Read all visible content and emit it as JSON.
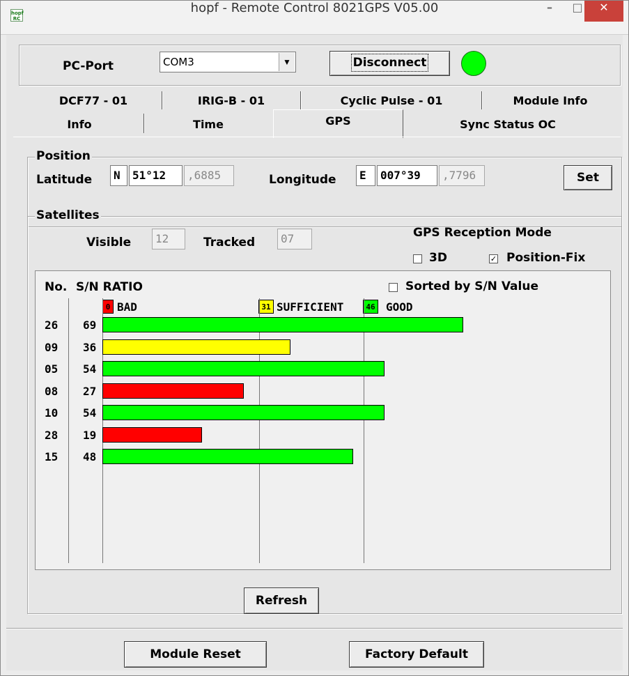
{
  "window": {
    "title": "hopf - Remote Control  8021GPS V05.00",
    "app_icon_text": "hopf RC",
    "minimize_symbol": "–",
    "maximize_symbol": "□",
    "close_symbol": "✕"
  },
  "connection": {
    "port_label": "PC-Port",
    "port_value": "COM3",
    "dropdown_arrow": "▼",
    "disconnect_label": "Disconnect",
    "status_color": "#00ff00"
  },
  "tabs": {
    "row1": [
      "DCF77 - 01",
      "IRIG-B - 01",
      "Cyclic Pulse - 01",
      "Module Info"
    ],
    "row2": [
      "Info",
      "Time",
      "GPS",
      "Sync Status OC"
    ],
    "active": "GPS"
  },
  "position": {
    "group_label": "Position",
    "latitude_label": "Latitude",
    "lat_hemisphere": "N",
    "lat_degrees": "51°12",
    "lat_minutes": ",6885",
    "longitude_label": "Longitude",
    "lon_hemisphere": "E",
    "lon_degrees": "007°39",
    "lon_minutes": ",7796",
    "set_label": "Set"
  },
  "satellites": {
    "group_label": "Satellites",
    "visible_label": "Visible",
    "visible_value": "12",
    "tracked_label": "Tracked",
    "tracked_value": "07",
    "reception_mode_label": "GPS Reception Mode",
    "mode_3d_label": "3D",
    "mode_3d_checked": false,
    "mode_posfix_label": "Position-Fix",
    "mode_posfix_checked": true
  },
  "sn_list": {
    "header_no": "No.",
    "header_ratio": "S/N RATIO",
    "sorted_label": "Sorted by S/N Value",
    "sorted_checked": false,
    "check_mark": "✓",
    "legend": [
      {
        "value": "0",
        "label": "BAD",
        "color": "#ff0000"
      },
      {
        "value": "31",
        "label": "SUFFICIENT",
        "color": "#ffff00"
      },
      {
        "value": "46",
        "label": "GOOD",
        "color": "#00ff00"
      }
    ]
  },
  "chart_data": {
    "type": "bar",
    "categories": [
      "26",
      "09",
      "05",
      "08",
      "10",
      "28",
      "15"
    ],
    "values": [
      69,
      36,
      54,
      27,
      54,
      19,
      48
    ],
    "value_labels": [
      "69",
      "36",
      "54",
      "27",
      "54",
      "19",
      "48"
    ],
    "thresholds": {
      "bad": 0,
      "sufficient": 31,
      "good": 46
    },
    "colors": {
      "bad": "#ff0000",
      "sufficient": "#ffff00",
      "good": "#00ff00"
    },
    "xlim": [
      0,
      100
    ],
    "gridlines_at": [
      0,
      30,
      50
    ]
  },
  "actions": {
    "refresh_label": "Refresh",
    "module_reset_label": "Module Reset",
    "factory_default_label": "Factory Default"
  }
}
